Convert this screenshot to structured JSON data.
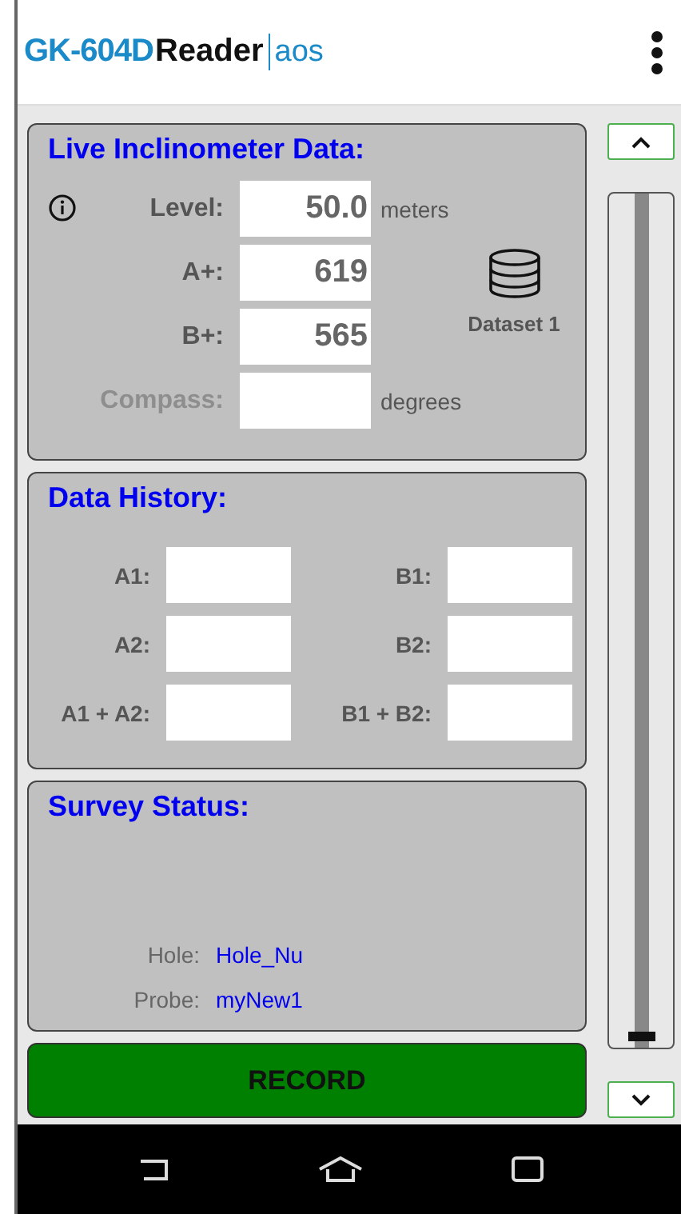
{
  "header": {
    "title_brand": "GK-604D",
    "title_app": "Reader",
    "title_suffix": "aos"
  },
  "live": {
    "title": "Live Inclinometer Data:",
    "rows": [
      {
        "label": "Level:",
        "value": "50.0",
        "unit": "meters",
        "disabled": false
      },
      {
        "label": "A+:",
        "value": "619",
        "disabled": false
      },
      {
        "label": "B+:",
        "value": "565",
        "disabled": false
      },
      {
        "label": "Compass:",
        "unit": "degrees",
        "disabled": true
      }
    ],
    "dataset": "Dataset 1"
  },
  "history": {
    "title": "Data History:",
    "fields": [
      {
        "label": "A1:"
      },
      {
        "label": "B1:"
      },
      {
        "label": "A2:"
      },
      {
        "label": "B2:"
      },
      {
        "label": "A1 + A2:"
      },
      {
        "label": "B1 + B2:"
      }
    ]
  },
  "survey": {
    "title": "Survey Status:",
    "rows": [
      {
        "label": "Hole:",
        "value": "Hole_Nu"
      },
      {
        "label": "Probe:",
        "value": "myNew1"
      }
    ]
  },
  "record_button": "RECORD",
  "slider": {
    "level": 0
  }
}
